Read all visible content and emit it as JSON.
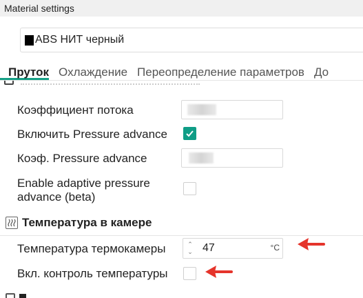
{
  "window": {
    "title": "Material settings"
  },
  "material": {
    "name": "ABS НИТ черный",
    "swatch_color": "#000000"
  },
  "tabs": [
    {
      "label": "Пруток",
      "active": true
    },
    {
      "label": "Охлаждение",
      "active": false
    },
    {
      "label": "Переопределение параметров",
      "active": false
    },
    {
      "label": "До",
      "active": false
    }
  ],
  "filament": {
    "flow_ratio_label": "Коэффициент потока",
    "pressure_advance_enable_label": "Включить Pressure advance",
    "pressure_advance_enabled": true,
    "pressure_advance_label": "Коэф. Pressure advance",
    "adaptive_pa_label_line1": "Enable adaptive pressure",
    "adaptive_pa_label_line2": "advance (beta)",
    "adaptive_pa_enabled": false
  },
  "chamber": {
    "section_title": "Температура в камере",
    "chamber_temp_label": "Температура термокамеры",
    "chamber_temp_value": "47",
    "chamber_temp_unit": "°C",
    "temp_control_label": "Вкл. контроль температуры",
    "temp_control_enabled": false
  },
  "colors": {
    "accent": "#0f9d86",
    "annotation_arrow": "#e5342b"
  }
}
